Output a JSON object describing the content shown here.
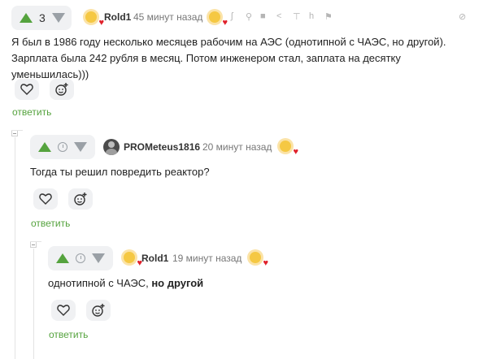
{
  "comments": [
    {
      "score": "3",
      "user": "Rold1",
      "time": "45 минут назад",
      "text": "Я был в 1986 году несколько месяцев рабочим на АЭС (однотипной с ЧАЭС, но другой). Зарплата была 242 рубля в месяц. Потом инженером стал, заплата на десятку уменьшилась)))",
      "reply": "ответить"
    },
    {
      "user": "PROMeteus1816",
      "time": "20 минут назад",
      "text": "Тогда ты решил повредить реактор?",
      "reply": "ответить"
    },
    {
      "user": "Rold1",
      "time": "19 минут назад",
      "text_plain": "однотипной с ЧАЭС, ",
      "text_bold": "но другой",
      "reply": "ответить"
    }
  ],
  "colors": {
    "accent": "#55a33e",
    "heart": "#e0212b",
    "muted": "#9aa0a6"
  },
  "icons": [
    "arrow-up-icon",
    "arrow-down-icon",
    "clock-icon",
    "heart-outline-icon",
    "add-emoji-icon",
    "rss-icon",
    "link-icon",
    "save-icon",
    "share-icon",
    "pin-icon",
    "hide-icon",
    "flag-icon",
    "block-icon"
  ]
}
